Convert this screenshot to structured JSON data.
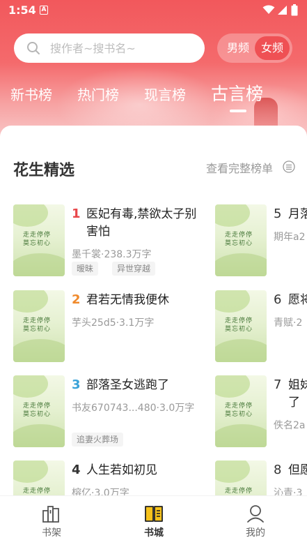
{
  "status": {
    "time": "1:54",
    "notification_letter": "A"
  },
  "search": {
    "placeholder": "搜作者~搜书名~"
  },
  "gender": {
    "male": "男频",
    "female": "女频",
    "selected": "female"
  },
  "tabs": [
    {
      "label": "新书榜",
      "active": false
    },
    {
      "label": "热门榜",
      "active": false
    },
    {
      "label": "现言榜",
      "active": false
    },
    {
      "label": "古言榜",
      "active": true
    }
  ],
  "section": {
    "title": "花生精选",
    "more": "查看完整榜单"
  },
  "cover": {
    "line1": "走走停停",
    "line2": "莫忘初心",
    "small": "一个人也可以\n好好照顾自己"
  },
  "books": [
    {
      "rank": "1",
      "rank_color": "#e8474a",
      "title": "医妃有毒,禁欲太子别害怕",
      "meta": "墨千裳·238.3万字",
      "tags": [
        "暧昧",
        "异世穿越"
      ]
    },
    {
      "rank": "2",
      "rank_color": "#f08a2c",
      "title": "君若无情我便休",
      "meta": "芋头25d5·3.1万字",
      "tags": []
    },
    {
      "rank": "3",
      "rank_color": "#3aa3d9",
      "title": "部落圣女逃跑了",
      "meta": "书友670743...480·3.0万字",
      "tags": [
        "追妻火葬场"
      ]
    },
    {
      "rank": "4",
      "rank_color": "#333333",
      "title": "人生若如初见",
      "meta": "榕亿·3.0万字",
      "tags": []
    }
  ],
  "books_right": [
    {
      "rank": "5",
      "title": "月落",
      "meta": "期年a2"
    },
    {
      "rank": "6",
      "title": "愿将",
      "meta": "青赋·2"
    },
    {
      "rank": "7",
      "title": "姐妹\n了",
      "meta": "佚名2a"
    },
    {
      "rank": "8",
      "title": "但愿",
      "meta": "沁青·3"
    }
  ],
  "nav": [
    {
      "label": "书架",
      "icon": "bookshelf-icon",
      "active": false
    },
    {
      "label": "书城",
      "icon": "book-open-icon",
      "active": true
    },
    {
      "label": "我的",
      "icon": "user-icon",
      "active": false
    }
  ],
  "colors": {
    "header_red": "#f2585c",
    "accent_yellow": "#f6c21c",
    "active_pill": "#ef5054"
  }
}
